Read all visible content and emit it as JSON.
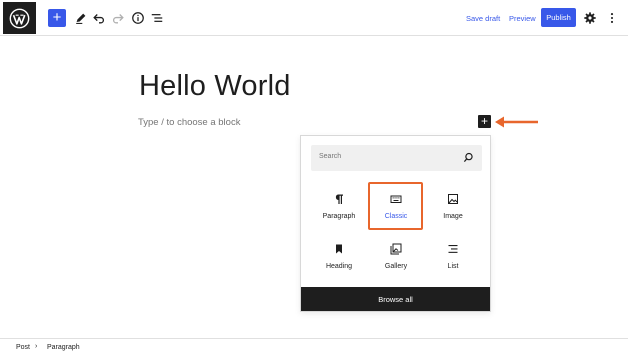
{
  "toolbar": {
    "logo_icon": "wordpress-icon",
    "add_block_symbol": "+",
    "tools_icon": "pencil-icon",
    "undo_icon": "undo-icon",
    "redo_icon": "redo-icon",
    "details_icon": "info-icon",
    "outline_icon": "list-view-icon",
    "save_draft_label": "Save draft",
    "preview_label": "Preview",
    "publish_label": "Publish",
    "settings_icon": "gear-icon",
    "options_icon": "vertical-ellipsis-icon",
    "accent_color": "#3858e9"
  },
  "editor": {
    "title": "Hello World",
    "placeholder": "Type / to choose a block",
    "inserter_symbol": "+"
  },
  "annotation": {
    "arrow_color": "#e8662c",
    "highlight_color": "#e8662c"
  },
  "inserter": {
    "search_placeholder": "Search",
    "blocks": [
      {
        "label": "Paragraph",
        "icon": "pilcrow-icon"
      },
      {
        "label": "Classic",
        "icon": "keyboard-icon",
        "selected": true
      },
      {
        "label": "Image",
        "icon": "image-icon"
      },
      {
        "label": "Heading",
        "icon": "bookmark-icon"
      },
      {
        "label": "Gallery",
        "icon": "gallery-icon"
      },
      {
        "label": "List",
        "icon": "list-icon"
      }
    ],
    "browse_all_label": "Browse all"
  },
  "breadcrumb": {
    "items": [
      "Post",
      "Paragraph"
    ],
    "separator": "›"
  }
}
